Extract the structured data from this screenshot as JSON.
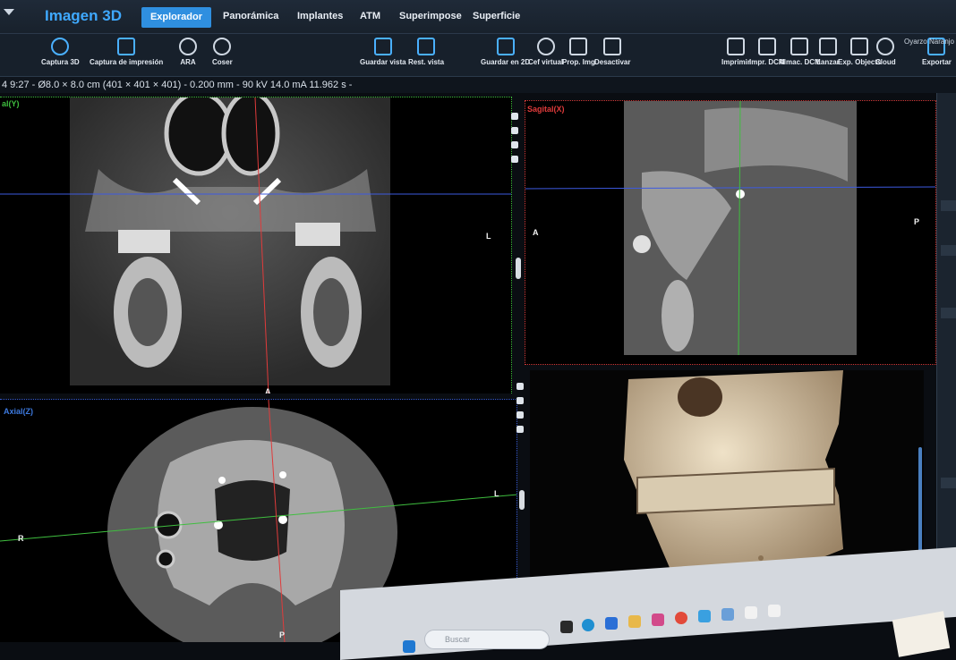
{
  "app": {
    "title": "Imagen 3D",
    "user": "Oyarzo Naranjo"
  },
  "tabs": [
    {
      "label": "Explorador",
      "active": true
    },
    {
      "label": "Panorámica"
    },
    {
      "label": "Implantes"
    },
    {
      "label": "ATM"
    },
    {
      "label": "Superimpose"
    },
    {
      "label": "Superficie"
    }
  ],
  "toolbar": {
    "capture3d": "Captura 3D",
    "capture_print": "Captura de impresión",
    "ara": "ARA",
    "coser": "Coser",
    "save_view": "Guardar vista",
    "rest_view": "Rest. vista",
    "save_2d": "Guardar en 2D",
    "cef_virtual": "Cef virtual",
    "prop_img": "Prop. Img",
    "deactivate": "Desactivar",
    "print": "Imprimir",
    "print_dcm": "Impr. DCM",
    "store_dcm": "Almac. DCM",
    "launch": "Lanzar",
    "exp_objects": "Exp. Objects",
    "cloud": "Cloud",
    "export": "Exportar"
  },
  "infobar": "4 9:27 - Ø8.0 × 8.0 cm (401 × 401 × 401) - 0.200 mm - 90 kV 14.0 mA 11.962 s -",
  "viewports": {
    "coronal": {
      "label": "al(Y)",
      "right": "L",
      "bottom": "A"
    },
    "sagittal": {
      "label": "Sagital(X)",
      "left": "A",
      "right": "P"
    },
    "axial": {
      "label": "Axial(Z)",
      "left": "R",
      "right": "L",
      "top": "A",
      "bottom": "P"
    }
  },
  "taskbar": {
    "search_placeholder": "Buscar"
  },
  "colors": {
    "accent": "#2f8fe0",
    "coronal_border": "#3fbf3f",
    "sagittal_border": "#d33a3a",
    "axial_border": "#3a5fd9"
  }
}
